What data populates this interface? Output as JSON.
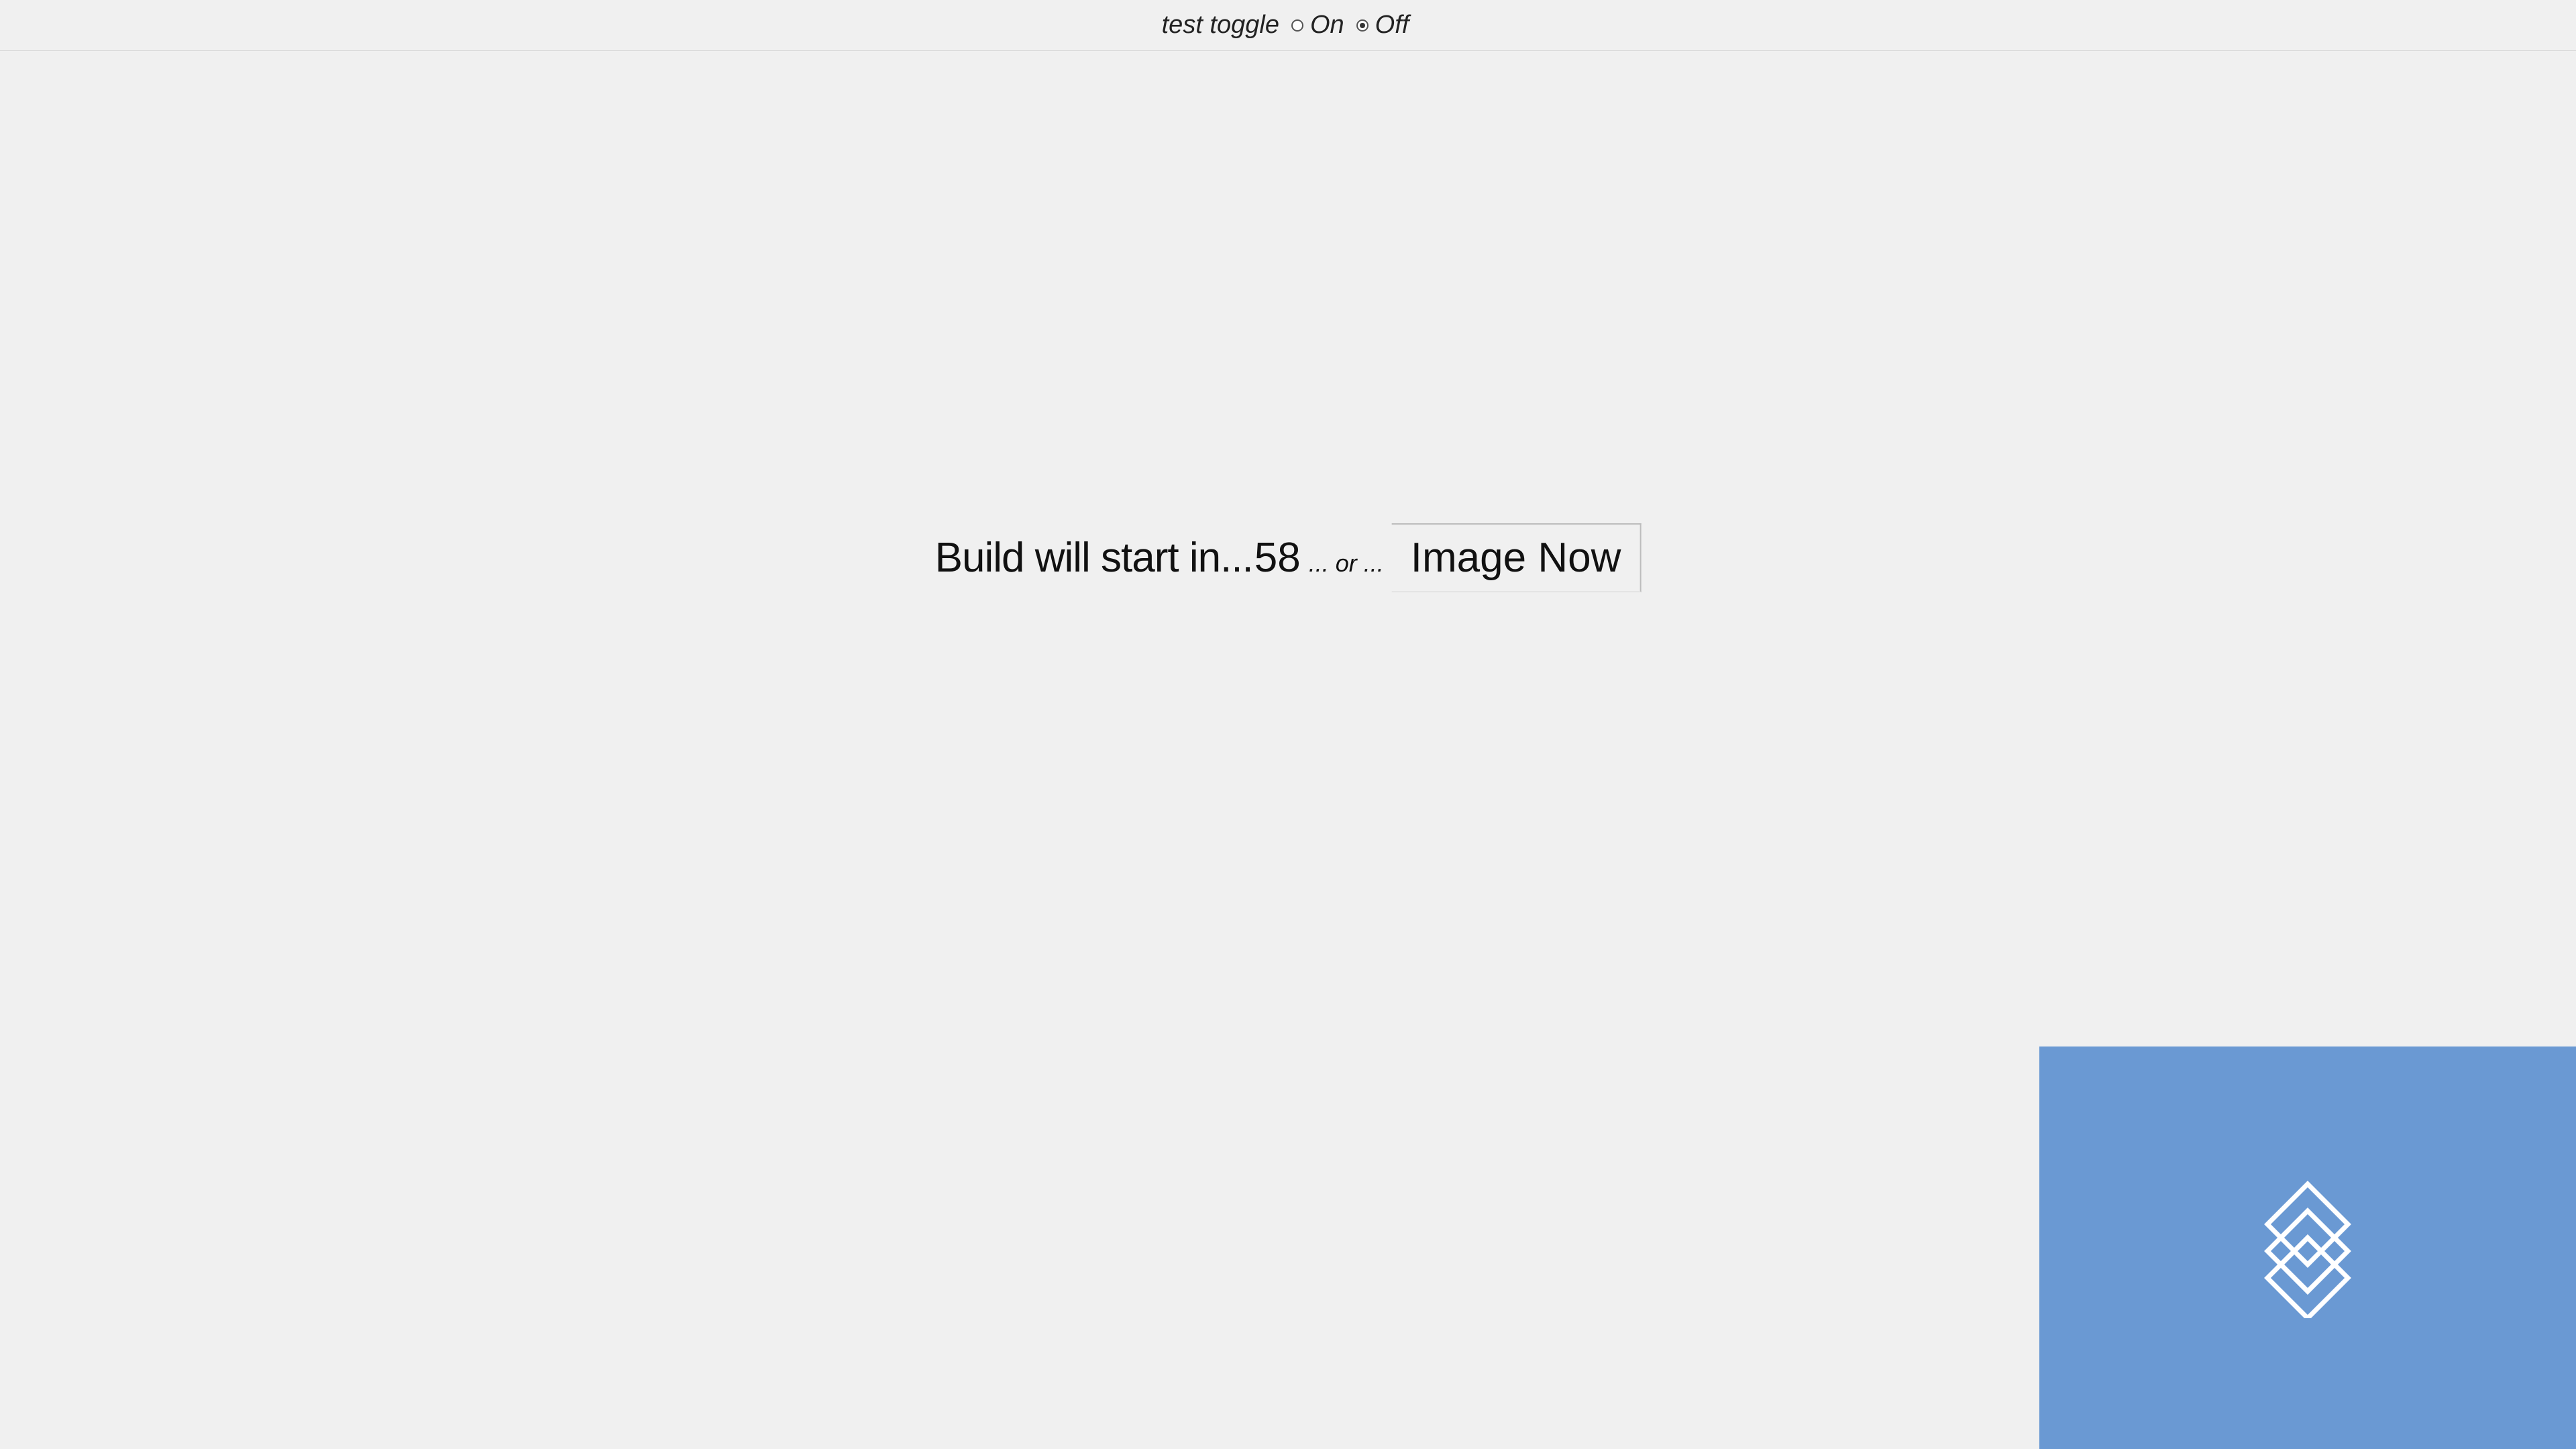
{
  "topbar": {
    "label": "test toggle",
    "options": [
      {
        "label": "On",
        "selected": false
      },
      {
        "label": "Off",
        "selected": true
      }
    ]
  },
  "main": {
    "build_text": "Build will start in...",
    "countdown": "58",
    "or_text": "... or ...",
    "button_label": "Image Now"
  },
  "panel": {
    "color": "#6a99d3",
    "icon": "stacked-diamonds-icon"
  }
}
